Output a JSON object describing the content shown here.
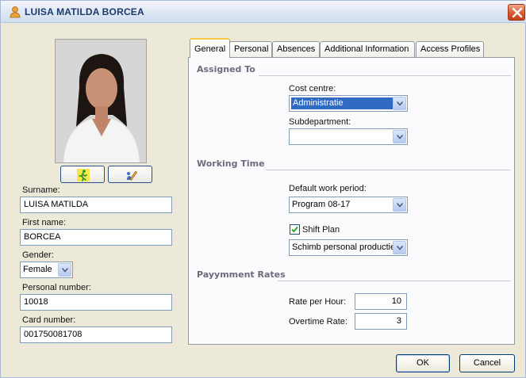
{
  "window": {
    "title": "LUISA MATILDA BORCEA",
    "title_icon": "person-icon",
    "close_icon": "close-icon"
  },
  "photo_buttons": [
    {
      "icon": "run-figure-icon"
    },
    {
      "icon": "edit-pencil-icon"
    }
  ],
  "person": {
    "surname_label": "Surname:",
    "surname": "LUISA MATILDA",
    "first_name_label": "First name:",
    "first_name": "BORCEA",
    "gender_label": "Gender:",
    "gender": "Female",
    "personal_number_label": "Personal number:",
    "personal_number": "10018",
    "card_number_label": "Card number:",
    "card_number": "001750081708"
  },
  "tabs": [
    {
      "label": "General",
      "active": true
    },
    {
      "label": "Personal",
      "active": false
    },
    {
      "label": "Absences",
      "active": false
    },
    {
      "label": "Additional Information",
      "active": false
    },
    {
      "label": "Access Profiles",
      "active": false
    }
  ],
  "general": {
    "assigned_to": {
      "title": "Assigned To",
      "cost_centre_label": "Cost centre:",
      "cost_centre": "Administratie",
      "subdepartment_label": "Subdepartment:",
      "subdepartment": ""
    },
    "working_time": {
      "title": "Working Time",
      "default_work_period_label": "Default work period:",
      "default_work_period": "Program 08-17",
      "shift_plan_label": "Shift Plan",
      "shift_plan_checked": true,
      "shift_plan_value": "Schimb personal productie"
    },
    "payment_rates": {
      "title": "Payymment Rates",
      "rate_per_hour_label": "Rate per Hour:",
      "rate_per_hour": "10",
      "overtime_rate_label": "Overtime Rate:",
      "overtime_rate": "3"
    }
  },
  "buttons": {
    "ok": "OK",
    "cancel": "Cancel"
  },
  "colors": {
    "dialog_bg": "#ECE9D8",
    "selection": "#316AC5",
    "title_text": "#1B3A6E",
    "close_button": "#D8552E",
    "active_tab_highlight": "#FFC83C"
  }
}
